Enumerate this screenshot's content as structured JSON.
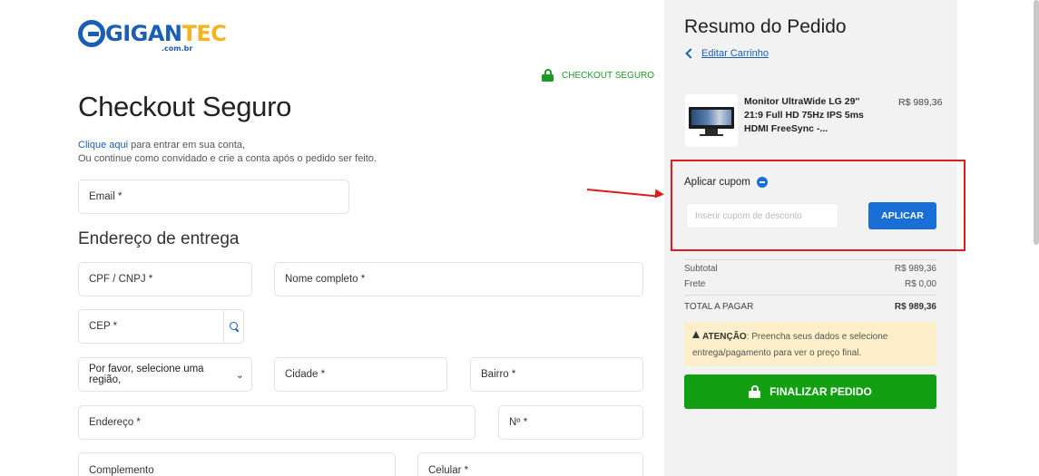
{
  "logo": {
    "main": "GIGAN",
    "accent": "TEC",
    "sub": ".com.br",
    "brand_color": "#1a5fb4",
    "accent_color": "#f2b51c"
  },
  "secure_badge": {
    "label": "CHECKOUT SEGURO",
    "icon": "lock-icon",
    "color": "#1e9a28"
  },
  "page_title": "Checkout Seguro",
  "login_hint": {
    "link": "Clique aqui",
    "rest": " para entrar em sua conta,",
    "line2": "Ou continue como convidado e crie a conta após o pedido ser feito."
  },
  "fields": {
    "email": "Email *",
    "cpf": "CPF / CNPJ *",
    "name": "Nome completo *",
    "cep": "CEP *",
    "region": "Por favor, selecione uma região,",
    "city": "Cidade *",
    "district": "Bairro *",
    "address": "Endereço *",
    "number": "Nº *",
    "complement": "Complemento",
    "phone": "Celular *"
  },
  "shipping_section": "Endereço de entrega",
  "summary": {
    "title": "Resumo do Pedido",
    "edit_cart": "Editar Carrinho",
    "product": {
      "name": "Monitor UltraWide LG 29'' 21:9 Full HD 75Hz IPS 5ms HDMI FreeSync -...",
      "price": "R$ 989,36"
    },
    "coupon": {
      "label": "Aplicar cupom",
      "placeholder": "Inserir cupom de desconto",
      "button": "APLICAR"
    },
    "subtotal_label": "Subtotal",
    "subtotal_value": "R$ 989,36",
    "shipping_label": "Frete",
    "shipping_value": "R$ 0,00",
    "total_label": "TOTAL A PAGAR",
    "total_value": "R$ 989,36",
    "warning_strong": "ATENÇÃO",
    "warning_text": ": Preencha seus dados e selecione entrega/pagamento para ver o preço final.",
    "finish_button": "FINALIZAR PEDIDO"
  },
  "colors": {
    "highlight": "#e01b1b",
    "primary": "#1a6fd6",
    "success": "#12a012"
  }
}
